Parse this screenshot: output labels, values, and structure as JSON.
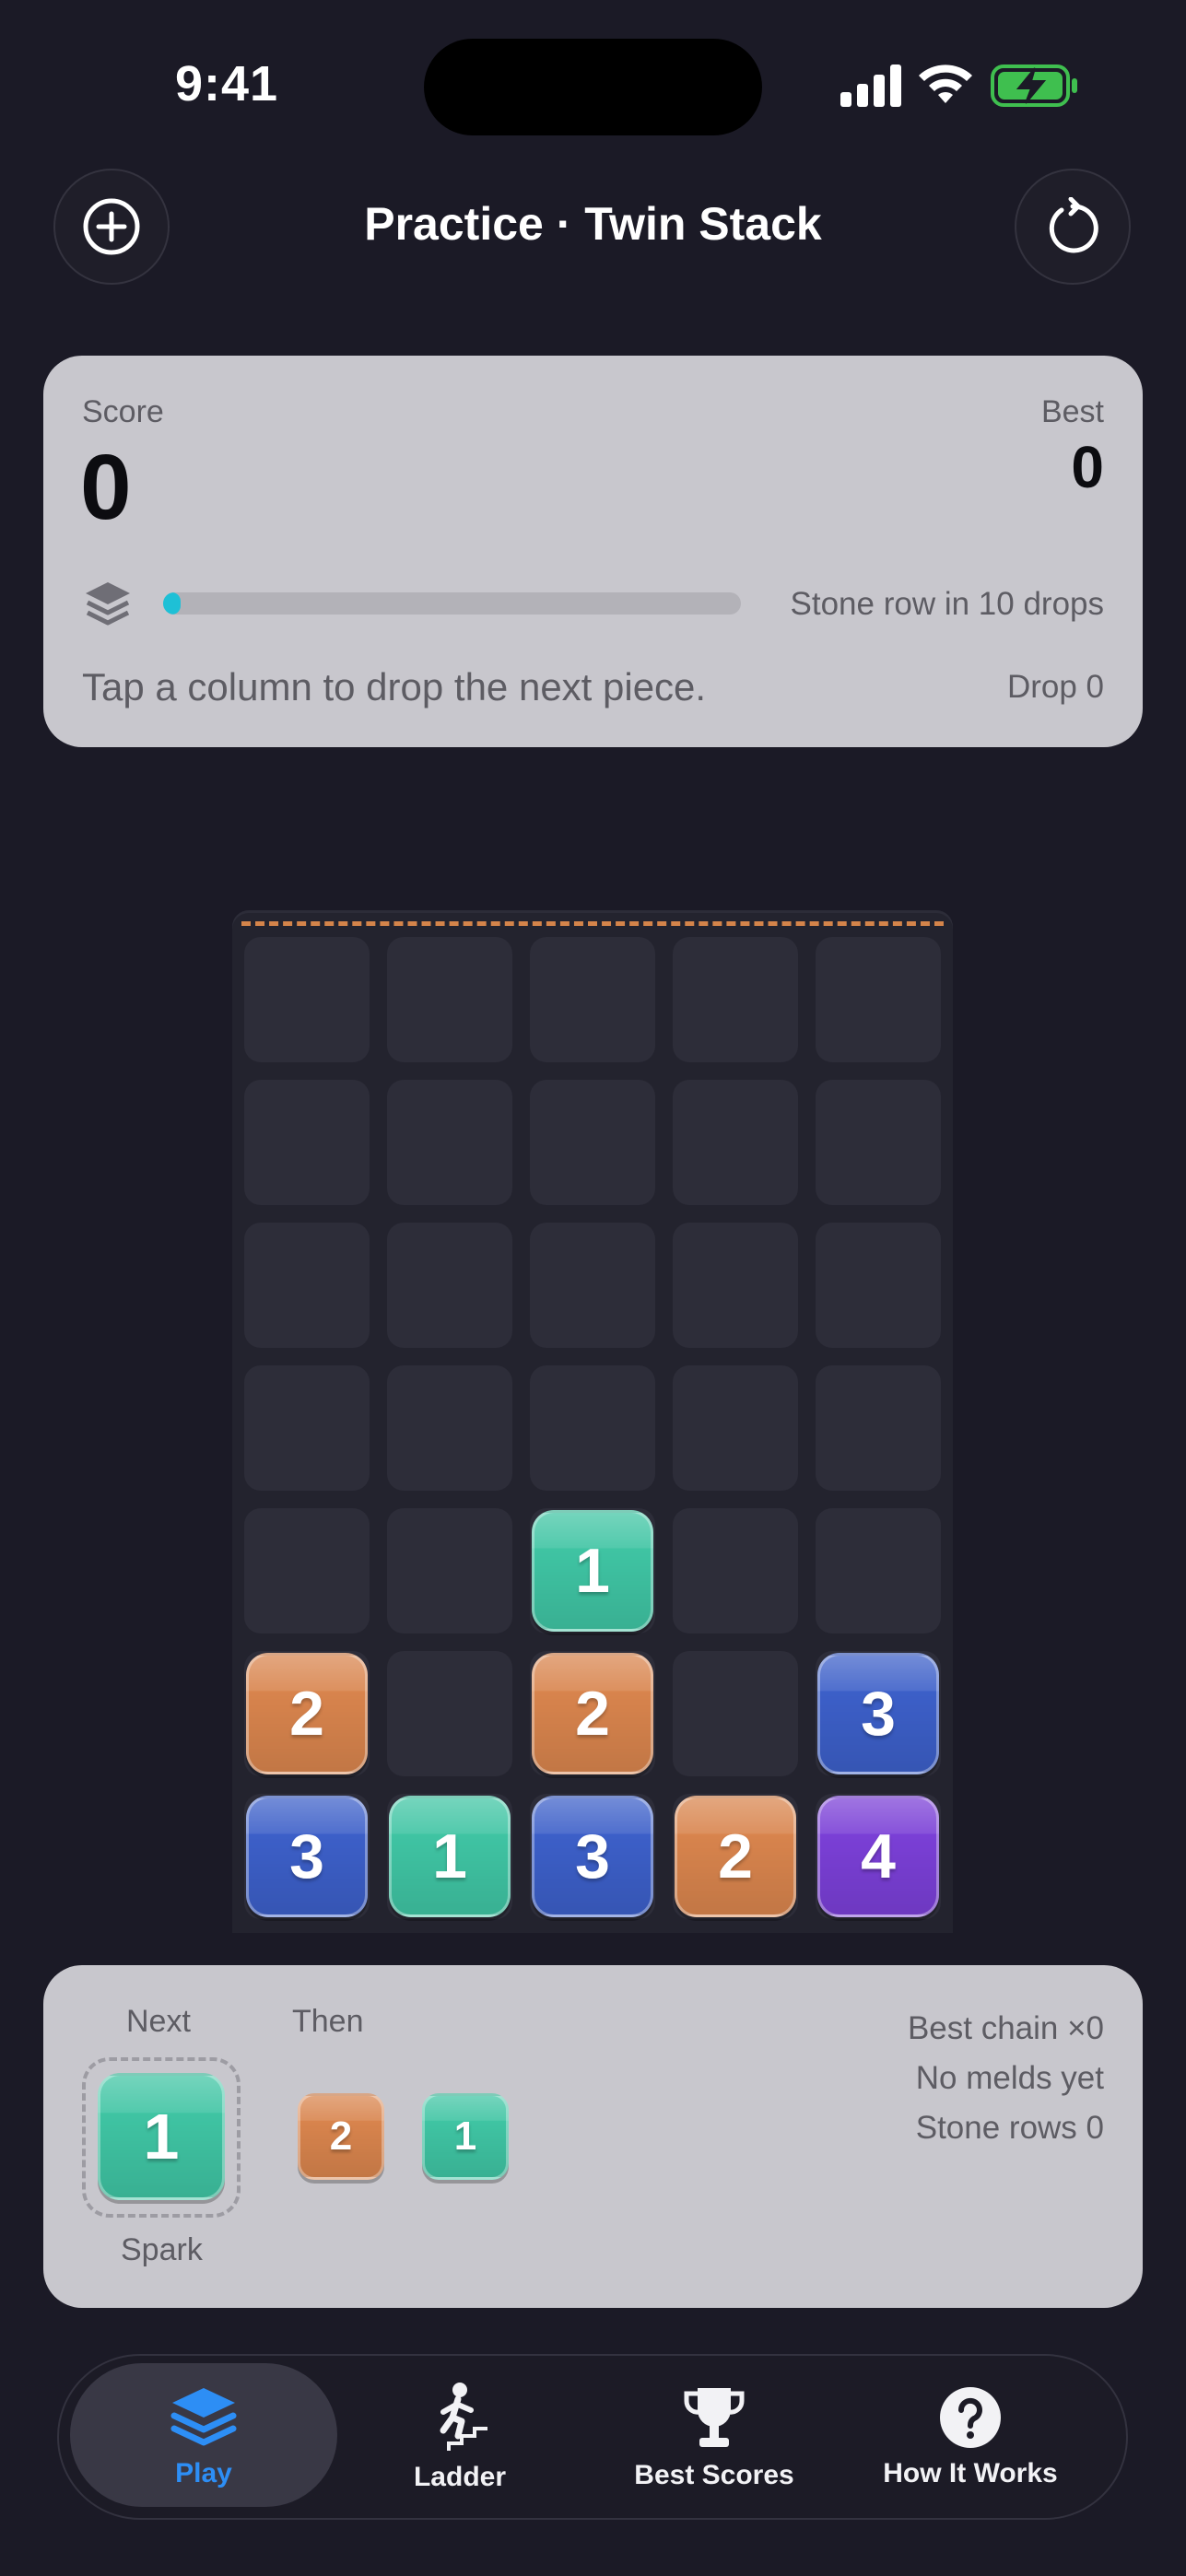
{
  "status": {
    "time": "9:41"
  },
  "header": {
    "title": "Practice · Twin Stack"
  },
  "score_card": {
    "score_label": "Score",
    "score_value": "0",
    "best_label": "Best",
    "best_value": "0",
    "progress_fraction": 0.02,
    "stone_text": "Stone row in 10 drops",
    "hint": "Tap a column to drop the next piece.",
    "drop_text": "Drop 0"
  },
  "board": {
    "columns": 5,
    "rows": 7,
    "tiles": [
      {
        "row": 4,
        "col": 2,
        "value": "1",
        "kind": "teal"
      },
      {
        "row": 5,
        "col": 0,
        "value": "2",
        "kind": "orange"
      },
      {
        "row": 5,
        "col": 2,
        "value": "2",
        "kind": "orange"
      },
      {
        "row": 5,
        "col": 4,
        "value": "3",
        "kind": "blue"
      },
      {
        "row": 6,
        "col": 0,
        "value": "3",
        "kind": "blue"
      },
      {
        "row": 6,
        "col": 1,
        "value": "1",
        "kind": "teal"
      },
      {
        "row": 6,
        "col": 2,
        "value": "3",
        "kind": "blue"
      },
      {
        "row": 6,
        "col": 3,
        "value": "2",
        "kind": "orange"
      },
      {
        "row": 6,
        "col": 4,
        "value": "4",
        "kind": "purple"
      }
    ]
  },
  "colors": {
    "teal": "#3fc4a3",
    "orange": "#d8844d",
    "blue": "#3c5fc8",
    "purple": "#7a3fd6",
    "accent": "#2d8ef5",
    "progress": "#1ec0d6"
  },
  "next_card": {
    "next_label": "Next",
    "then_label": "Then",
    "next_value": "1",
    "next_name": "Spark",
    "then_values": [
      "2",
      "1"
    ],
    "best_chain": "Best chain ×0",
    "melds": "No melds yet",
    "stone_rows": "Stone rows 0"
  },
  "tabs": [
    {
      "label": "Play",
      "icon": "stack-layers-icon"
    },
    {
      "label": "Ladder",
      "icon": "stairs-climber-icon"
    },
    {
      "label": "Best Scores",
      "icon": "trophy-icon"
    },
    {
      "label": "How It Works",
      "icon": "question-circle-icon"
    }
  ]
}
